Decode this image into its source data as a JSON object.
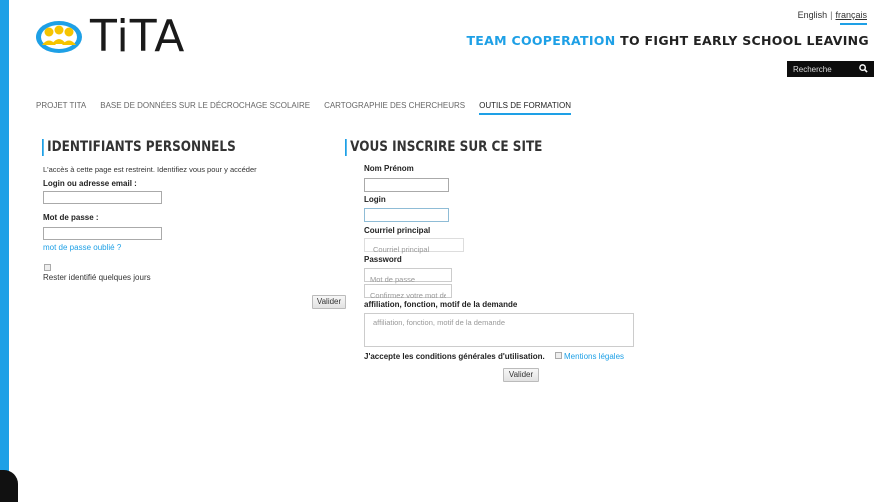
{
  "brand": {
    "logo_text": "TiTA"
  },
  "lang": {
    "en": "English",
    "sep": "|",
    "fr": "français"
  },
  "tagline": {
    "blue": "TEAM COOPERATION",
    "dark": " TO FIGHT EARLY SCHOOL LEAVING"
  },
  "search": {
    "placeholder": "Recherche"
  },
  "nav": [
    {
      "label": "PROJET TITA"
    },
    {
      "label": "BASE DE DONNÉES SUR LE DÉCROCHAGE SCOLAIRE"
    },
    {
      "label": "CARTOGRAPHIE DES CHERCHEURS"
    },
    {
      "label": "OUTILS DE FORMATION"
    }
  ],
  "login": {
    "title": "IDENTIFIANTS PERSONNELS",
    "intro": "L'accès à cette page est restreint. Identifiez vous pour y accéder",
    "user_label": "Login ou adresse email :",
    "user_value": "",
    "pass_label": "Mot de passe :",
    "pass_value": "",
    "forgot": "mot de passe oublié ?",
    "remember": "Rester identifié quelques jours",
    "submit": "Valider"
  },
  "register": {
    "title": "VOUS INSCRIRE SUR CE SITE",
    "name_label": "Nom Prénom",
    "login_label": "Login",
    "email_label": "Courriel principal",
    "email_placeholder": "Courriel principal",
    "password_label": "Password",
    "password_placeholder": "Mot de passe",
    "confirm_placeholder": "Confirmez votre mot de",
    "affil_label": "affiliation, fonction, motif de la demande",
    "affil_placeholder": "affiliation, fonction, motif de la demande",
    "terms_text": "J'accepte les conditions générales d'utilisation.",
    "terms_link": "Mentions légales",
    "submit": "Valider"
  },
  "colors": {
    "accent": "#1ea0e6",
    "text": "#333333"
  }
}
